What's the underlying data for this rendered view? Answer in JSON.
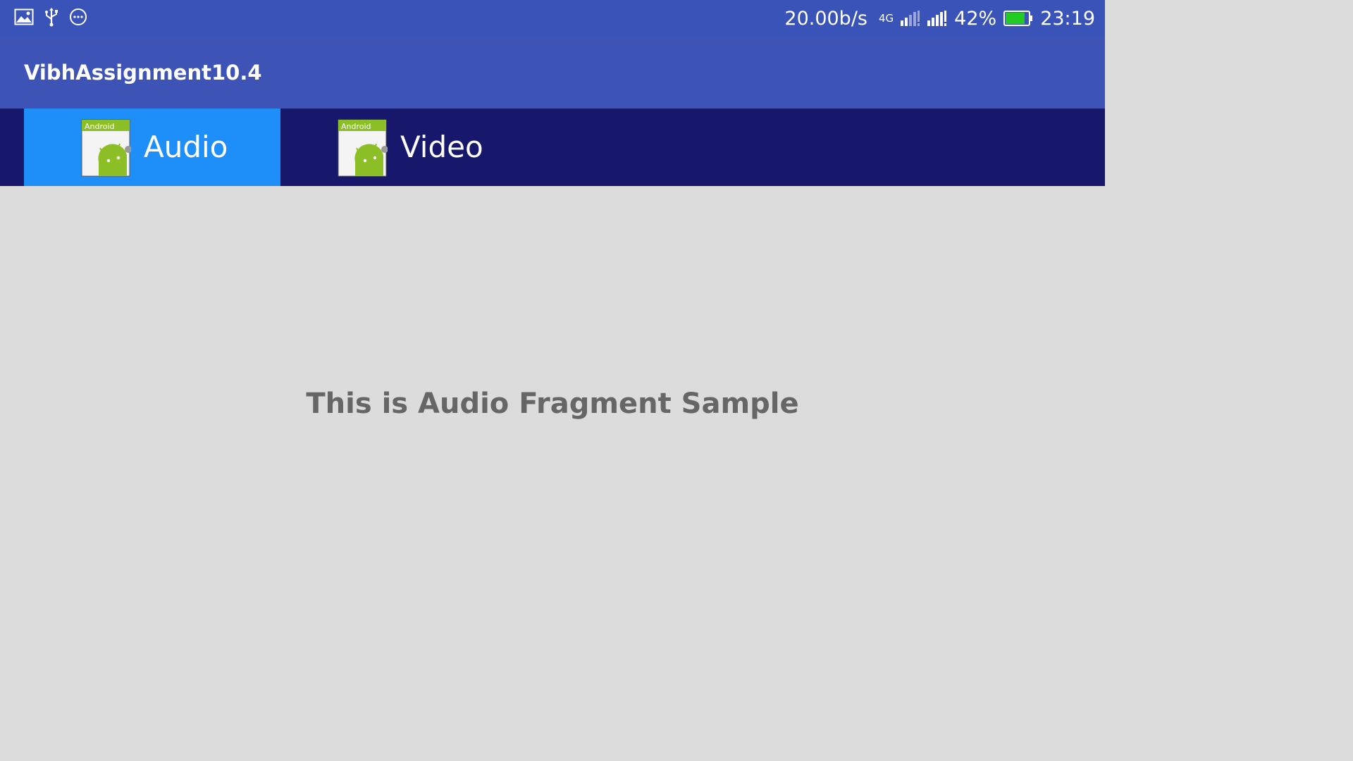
{
  "status_bar": {
    "left_icons": [
      "image-icon",
      "usb-icon",
      "more-circle-icon"
    ],
    "net_speed": "20.00b/s",
    "network_type": "4G",
    "battery_percent": "42%",
    "battery_level": 0.42,
    "time": "23:19"
  },
  "app_bar": {
    "title": "VibhAssignment10.4"
  },
  "tabs": [
    {
      "label": "Audio",
      "icon": "android-app-icon",
      "icon_text": "Android",
      "selected": true
    },
    {
      "label": "Video",
      "icon": "android-app-icon",
      "icon_text": "Android",
      "selected": false
    }
  ],
  "content": {
    "text": "This is Audio Fragment Sample"
  },
  "colors": {
    "status_bar": "#3a53b8",
    "app_bar": "#3d53b6",
    "tab_bar": "#17186b",
    "tab_selected": "#1e8ff8",
    "content_bg": "#dcdcdc",
    "content_text": "#666666",
    "battery_fill": "#22cc22"
  }
}
